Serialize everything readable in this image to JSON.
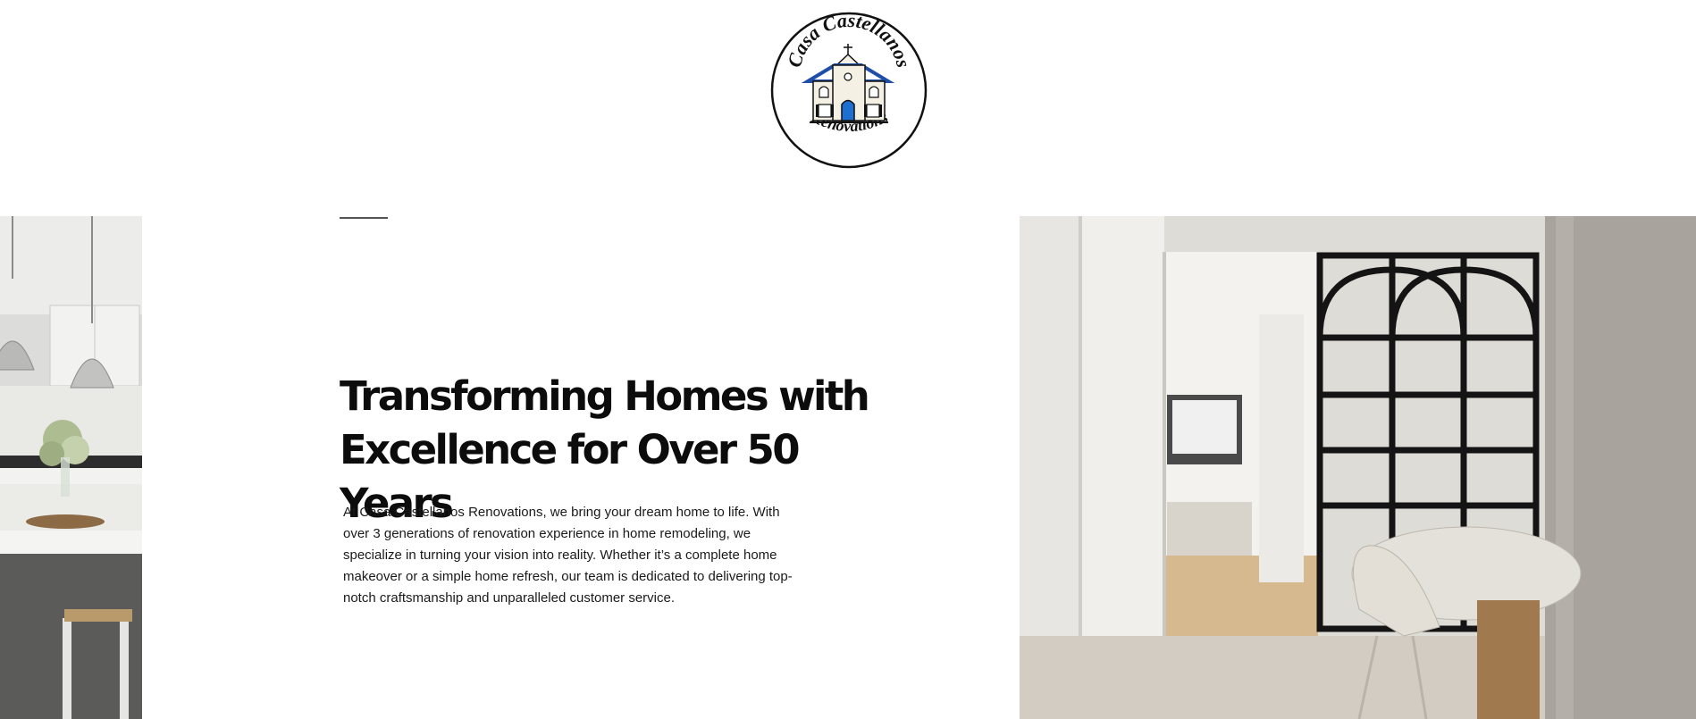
{
  "brand": {
    "logo_top_text": "Casa Castellanos",
    "logo_bottom_text": "Renovations",
    "logo_alt": "Casa Castellanos Renovations logo"
  },
  "hero": {
    "heading_line1": "Transforming Homes with",
    "heading_line2": "Excellence for Over 50 Years",
    "description": "At Casa Castellanos Renovations, we bring your dream home to life. With over 3 generations of renovation experience in home remodeling, we specialize in turning your vision into reality. Whether it’s a complete home makeover or a simple home refresh, our team is dedicated to delivering top-notch craftsmanship and unparalleled customer service.",
    "left_image_alt": "White kitchen with marble island and pendant lights",
    "right_image_alt": "Modern dining room with black arched glass partition"
  },
  "colors": {
    "accent_blue": "#1f6fd1",
    "heading": "#0c0c0c",
    "body_text": "#1a1a1a"
  }
}
